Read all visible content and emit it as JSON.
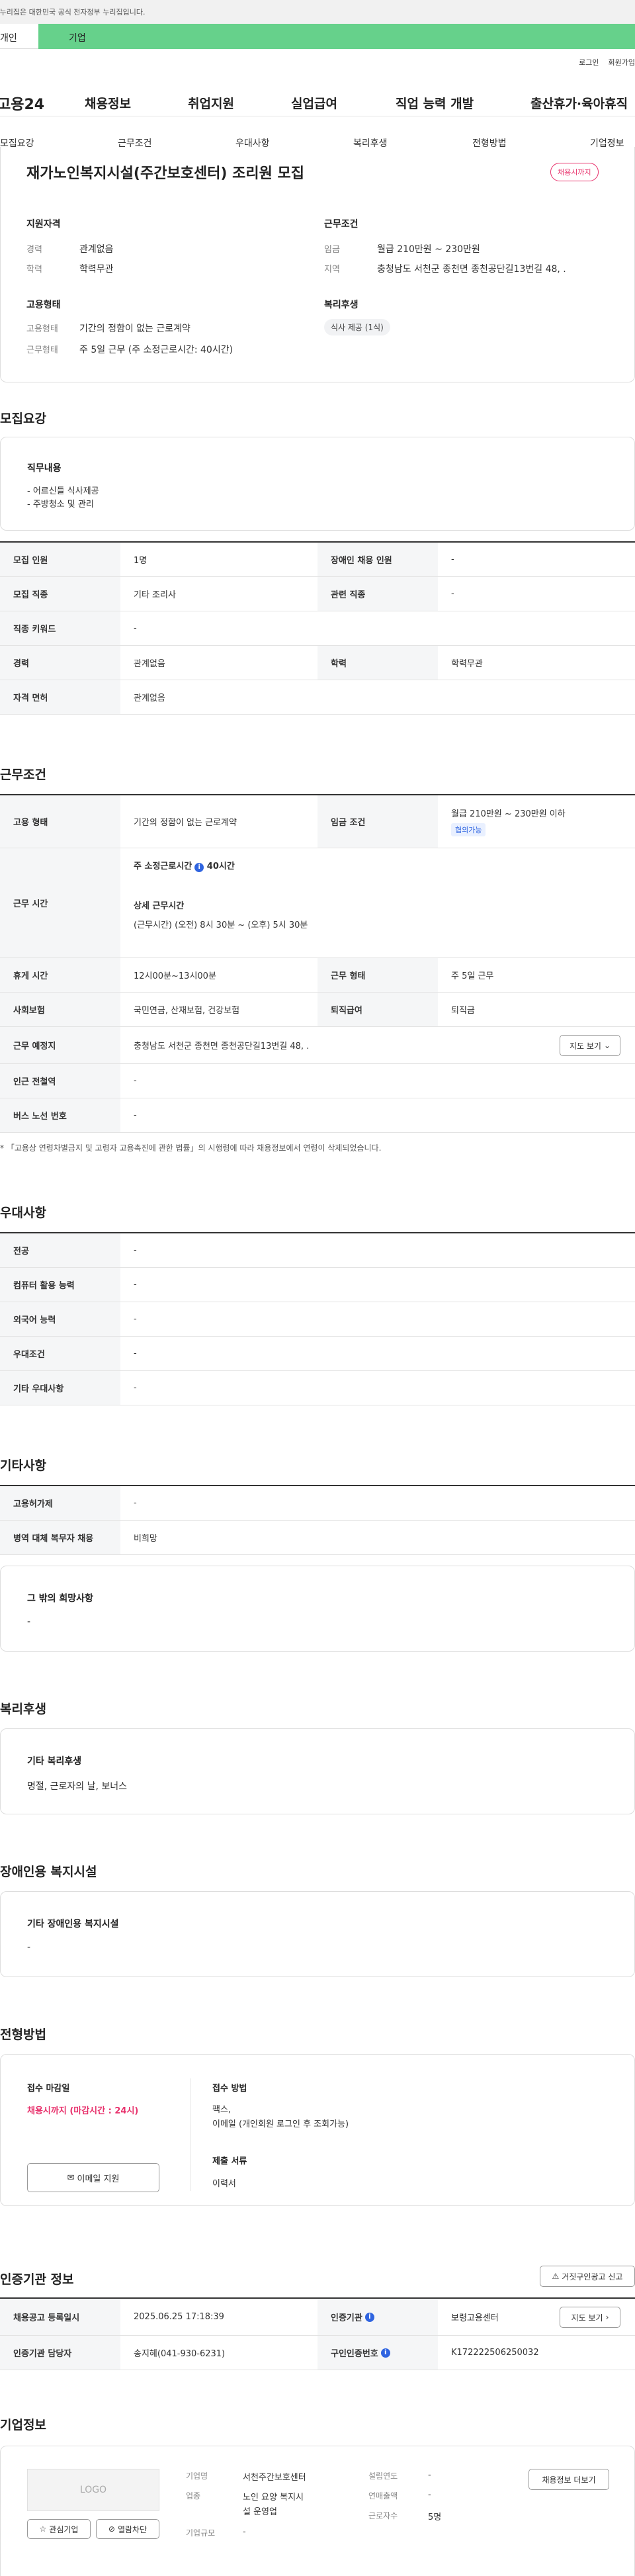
{
  "topbar": {
    "notice": "이 누리집은 대한민국 공식 전자정부 누리집입니다."
  },
  "usertype": {
    "personal": "개인",
    "company": "기업"
  },
  "util": {
    "login": "로그인",
    "join": "회원가입"
  },
  "gnb": {
    "logo": "고용24",
    "items": [
      "채용정보",
      "취업지원",
      "실업급여",
      "직업 능력 개발",
      "출산휴가·육아휴직"
    ]
  },
  "subnav": [
    "모집요강",
    "근무조건",
    "우대사항",
    "복리후생",
    "전형방법",
    "기업정보"
  ],
  "summary": {
    "title": "재가노인복지시설(주간보호센터) 조리원 모집",
    "status": "채용시까지",
    "qual_title": "지원자격",
    "career_l": "경력",
    "career_v": "관계없음",
    "edu_l": "학력",
    "edu_v": "학력무관",
    "work_title": "근무조건",
    "wage_l": "임금",
    "wage_v": "월급 210만원 ~ 230만원",
    "area_l": "지역",
    "area_v": "충청남도 서천군 종천면 종천공단길13번길 48, .",
    "emp_title": "고용형태",
    "emp_type_l": "고용형태",
    "emp_type_v": "기간의 정함이 없는 근로계약",
    "emp_hours_l": "근무형태",
    "emp_hours_v": "주 5일 근무 (주 소정근로시간: 40시간)",
    "welfare_title": "복리후생",
    "welfare_chip": "식사 제공 (1식)"
  },
  "recruit": {
    "heading": "모집요강",
    "duty_title": "직무내용",
    "duty_lines": [
      "- 어르신들 식사제공",
      "- 주방청소 및 관리"
    ],
    "rows": [
      {
        "k1": "모집 인원",
        "v1": "1명",
        "k2": "장애인 채용 인원",
        "v2": "-"
      },
      {
        "k1": "모집 직종",
        "v1": "기타 조리사",
        "k2": "관련 직종",
        "v2": "-"
      },
      {
        "k1": "직종 키워드",
        "v1": "-"
      },
      {
        "k1": "경력",
        "v1": "관계없음",
        "k2": "학력",
        "v2": "학력무관"
      },
      {
        "k1": "자격 면허",
        "v1": "관계없음"
      }
    ]
  },
  "conditions": {
    "heading": "근무조건",
    "emp_k": "고용 형태",
    "emp_v": "기간의 정함이 없는 근로계약",
    "wage_k": "임금 조건",
    "wage_v": "월급 210만원 ~ 230만원 이하",
    "wage_tag": "협의가능",
    "time_k": "근무 시간",
    "time_v1": "주 소정근로시간",
    "time_v1b": "40시간",
    "time_v2": "상세 근무시간",
    "time_v3": "(근무시간) (오전) 8시 30분 ~ (오후) 5시 30분",
    "rest_k": "휴게 시간",
    "rest_v": "12시00분~13시00분",
    "form_k": "근무 형태",
    "form_v": "주 5일 근무",
    "ins_k": "사회보험",
    "ins_v": "국민연금, 산재보험, 건강보험",
    "ret_k": "퇴직급여",
    "ret_v": "퇴직금",
    "place_k": "근무 예정지",
    "place_v": "충청남도 서천군 종천면 종천공단길13번길 48, .",
    "map_btn": "지도 보기",
    "station_k": "인근 전철역",
    "station_v": "-",
    "bus_k": "버스 노선 번호",
    "bus_v": "-",
    "note": "* 「고용상 연령차별금지 및 고령자 고용촉진에 관한 법률」의 시행령에 따라 채용정보에서 연령이 삭제되었습니다."
  },
  "prefer": {
    "heading": "우대사항",
    "rows": [
      {
        "k": "전공",
        "v": "-"
      },
      {
        "k": "컴퓨터 활용 능력",
        "v": "-"
      },
      {
        "k": "외국어 능력",
        "v": "-"
      },
      {
        "k": "우대조건",
        "v": "-"
      },
      {
        "k": "기타 우대사항",
        "v": "-"
      }
    ]
  },
  "etc": {
    "heading": "기타사항",
    "rows": [
      {
        "k": "고용허가제",
        "v": "-"
      },
      {
        "k": "병역 대체 복무자 채용",
        "v": "비희망"
      }
    ],
    "other_title": "그 밖의 희망사항",
    "other_v": "-"
  },
  "welfare": {
    "heading": "복리후생",
    "title": "기타 복리후생",
    "value": "명절, 근로자의 날, 보너스"
  },
  "disabled": {
    "heading": "장애인용 복지시설",
    "title": "기타 장애인용 복지시설",
    "value": "-"
  },
  "selection": {
    "heading": "전형방법",
    "deadline_title": "접수 마감일",
    "deadline_v": "채용시까지 (마감시간 : 24시)",
    "email_btn": "이메일 지원",
    "method_title": "접수 방법",
    "method_v1": "팩스,",
    "method_v2": "이메일 (개인회원 로그인 후 조회가능)",
    "docs_title": "제출 서류",
    "docs_v": "이력서"
  },
  "agency": {
    "heading": "인증기관 정보",
    "report_btn": "거짓구인광고 신고",
    "reg_k": "채용공고 등록일시",
    "reg_v": "2025.06.25 17:18:39",
    "cert_k": "인증기관",
    "cert_v": "보령고용센터",
    "map_btn": "지도 보기",
    "mgr_k": "인증기관 담당자",
    "mgr_v": "송지혜(041-930-6231)",
    "num_k": "구인인증번호",
    "num_v": "K172222506250032"
  },
  "company": {
    "heading": "기업정보",
    "logo": "LOGO",
    "interest_btn": "관심기업",
    "block_btn": "열람차단",
    "more_btn": "채용정보 더보기",
    "name_k": "기업명",
    "name_v": "서천주간보호센터",
    "year_k": "설립연도",
    "year_v": "-",
    "ind_k": "업종",
    "ind_v1": "노인 요양 복지시",
    "ind_v2": "설 운영업",
    "sales_k": "연매출액",
    "sales_v": "-",
    "emp_k": "근로자수",
    "emp_v": "5명",
    "size_k": "기업규모",
    "size_v": "-"
  }
}
